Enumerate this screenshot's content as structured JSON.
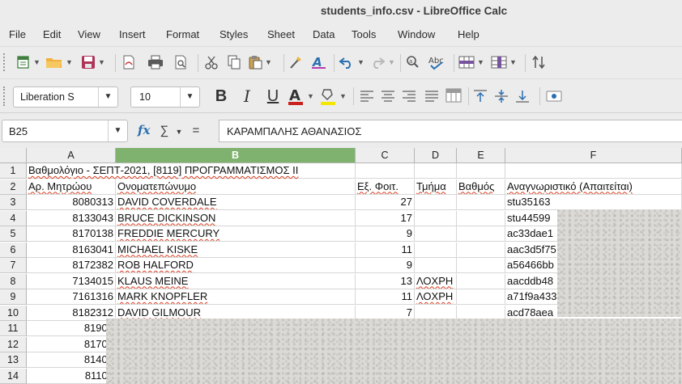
{
  "window": {
    "title": "students_info.csv - LibreOffice Calc"
  },
  "menu": [
    "File",
    "Edit",
    "View",
    "Insert",
    "Format",
    "Styles",
    "Sheet",
    "Data",
    "Tools",
    "Window",
    "Help"
  ],
  "toolbar": {
    "font_name": "Liberation S",
    "font_size": "10",
    "icons": [
      "new-icon",
      "open-icon",
      "save-icon",
      "export-pdf-icon",
      "print-icon",
      "print-preview-icon",
      "cut-icon",
      "copy-icon",
      "paste-icon",
      "clone-formatting-icon",
      "clear-formatting-icon",
      "undo-icon",
      "redo-icon",
      "find-replace-icon",
      "spelling-icon",
      "row-icon",
      "column-icon",
      "sort-ascending-icon",
      "bold-icon",
      "italic-icon",
      "underline-icon",
      "font-color-icon",
      "highlight-color-icon",
      "align-left-icon",
      "align-center-icon",
      "align-right-icon",
      "justify-icon",
      "merge-cells-icon",
      "align-top-icon",
      "align-middle-icon",
      "align-bottom-icon",
      "currency-icon"
    ],
    "bold": "B",
    "italic": "I",
    "underline": "U",
    "font_color_letter": "A",
    "spelling": "Abc"
  },
  "formula_bar": {
    "cell_ref": "B25",
    "fx": "fx",
    "sigma": "∑",
    "equals": "=",
    "content": "ΚΑΡΑΜΠΑΛΗΣ ΑΘΑΝΑΣΙΟΣ"
  },
  "colors": {
    "selected_column_header": "#7fb26e",
    "spell_underline": "#d9391c"
  },
  "sheet": {
    "columns": [
      "A",
      "B",
      "C",
      "D",
      "E",
      "F"
    ],
    "selected_column": "B",
    "rows": [
      {
        "n": "1",
        "a": "Βαθμολόγιο - ΣΕΠΤ-2021, [8119] ΠΡΟΓΡΑΜΜΑΤΙΣΜΟΣ ΙΙ",
        "b": "",
        "c": "",
        "d": "",
        "e": "",
        "f": ""
      },
      {
        "n": "2",
        "a": "Αρ. Μητρώου",
        "b": "Ονοματεπώνυμο",
        "c": "Εξ. Φοιτ.",
        "d": "Τμήμα",
        "e": "Βαθμός",
        "f": "Αναγνωριστικό (Απαιτείται)"
      },
      {
        "n": "3",
        "a": "8080313",
        "b": "DAVID COVERDALE",
        "c": "27",
        "d": "",
        "e": "",
        "f": "stu35163"
      },
      {
        "n": "4",
        "a": "8133043",
        "b": "BRUCE DICKINSON",
        "c": "17",
        "d": "",
        "e": "",
        "f": "stu44599"
      },
      {
        "n": "5",
        "a": "8170138",
        "b": "FREDDIE MERCURY",
        "c": "9",
        "d": "",
        "e": "",
        "f": "ac33dae1"
      },
      {
        "n": "6",
        "a": "8163041",
        "b": "MICHAEL KISKE",
        "c": "11",
        "d": "",
        "e": "",
        "f": "aac3d5f75"
      },
      {
        "n": "7",
        "a": "8172382",
        "b": "ROB HALFORD",
        "c": "9",
        "d": "",
        "e": "",
        "f": "a56466bb"
      },
      {
        "n": "8",
        "a": "7134015",
        "b": "KLAUS MEINE",
        "c": "13",
        "d": "ΛΟΧΡΗ",
        "e": "",
        "f": "aacddb48"
      },
      {
        "n": "9",
        "a": "7161316",
        "b": "MARK KNOPFLER",
        "c": "11",
        "d": "ΛΟΧΡΗ",
        "e": "",
        "f": "a71f9a433"
      },
      {
        "n": "10",
        "a": "8182312",
        "b": "DAVID GILMOUR",
        "c": "7",
        "d": "",
        "e": "",
        "f": "acd78aea"
      },
      {
        "n": "11",
        "a": "81900",
        "b": "",
        "c": "",
        "d": "",
        "e": "",
        "f": ""
      },
      {
        "n": "12",
        "a": "81700",
        "b": "",
        "c": "",
        "d": "",
        "e": "",
        "f": ""
      },
      {
        "n": "13",
        "a": "81400",
        "b": "",
        "c": "",
        "d": "",
        "e": "",
        "f": ""
      },
      {
        "n": "14",
        "a": "81100",
        "b": "",
        "c": "",
        "d": "",
        "e": "",
        "f": ""
      }
    ]
  }
}
